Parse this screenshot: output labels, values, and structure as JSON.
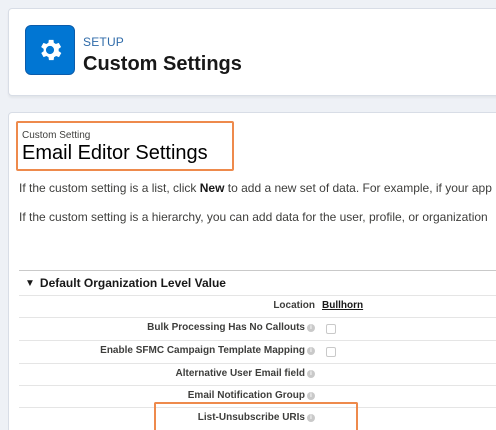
{
  "header": {
    "eyebrow": "SETUP",
    "title": "Custom Settings",
    "icon": "gear-icon",
    "icon_color": "#0176d3"
  },
  "page": {
    "eyebrow": "Custom Setting",
    "title": "Email Editor Settings",
    "desc1_pre": "If the custom setting is a list, click ",
    "desc1_bold": "New",
    "desc1_post": " to add a new set of data. For example, if your app",
    "desc2": "If the custom setting is a hierarchy, you can add data for the user, profile, or organization"
  },
  "section": {
    "title": "Default Organization Level Value",
    "rows": [
      {
        "label": "Location",
        "value": "Bullhorn",
        "help": false
      },
      {
        "label": "Bulk Processing Has No Callouts",
        "checkbox": true,
        "help": true
      },
      {
        "label": "Enable SFMC Campaign Template Mapping",
        "checkbox": true,
        "help": true
      },
      {
        "label": "Alternative User Email field",
        "help": true
      },
      {
        "label": "Email Notification Group",
        "help": true
      },
      {
        "label": "List-Unsubscribe URIs",
        "help": true
      }
    ]
  },
  "colors": {
    "highlight": "#ee8a4c",
    "brand": "#0176d3"
  }
}
